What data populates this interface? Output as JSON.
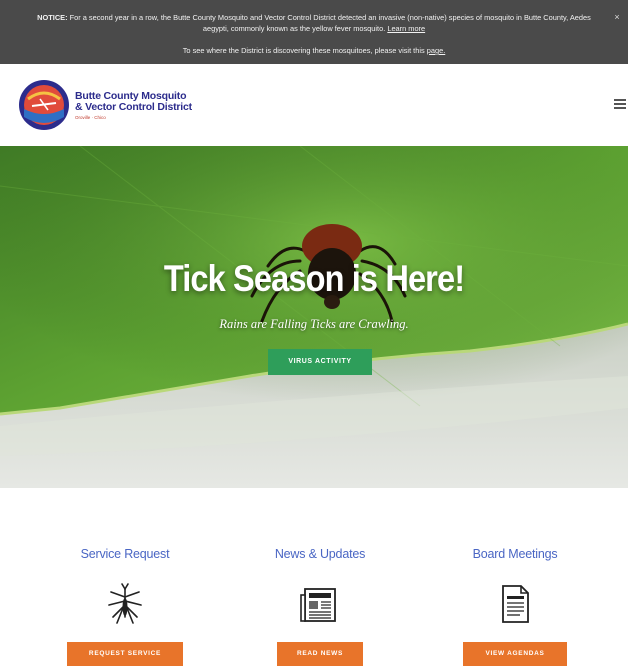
{
  "notice": {
    "label": "NOTICE:",
    "text": "For a second year in a row, the Butte County Mosquito and Vector Control District detected an invasive (non-native) species of mosquito in Butte County, Aedes aegypti, commonly known as the yellow fever mosquito.",
    "learn_more": "Learn more",
    "line2": "To see where the District is discovering these mosquitoes, please visit this",
    "line2_link": "page.",
    "close": "×"
  },
  "header": {
    "brand_line1": "Butte County Mosquito",
    "brand_line2": "& Vector Control District",
    "brand_sub": "Oroville · Chico"
  },
  "hero": {
    "title": "Tick Season is Here!",
    "subtitle": "Rains are Falling Ticks are Crawling.",
    "button": "VIRUS ACTIVITY"
  },
  "features": [
    {
      "title": "Service Request",
      "button": "REQUEST SERVICE",
      "icon": "mosquito-icon"
    },
    {
      "title": "News & Updates",
      "button": "READ NEWS",
      "icon": "newspaper-icon"
    },
    {
      "title": "Board Meetings",
      "button": "VIEW AGENDAS",
      "icon": "document-icon"
    }
  ],
  "colors": {
    "notice_bg": "#4a4a4a",
    "brand_blue": "#2c2c8c",
    "hero_button": "#2e9e5a",
    "feature_title": "#4a66c4",
    "feature_button": "#e8742a"
  }
}
